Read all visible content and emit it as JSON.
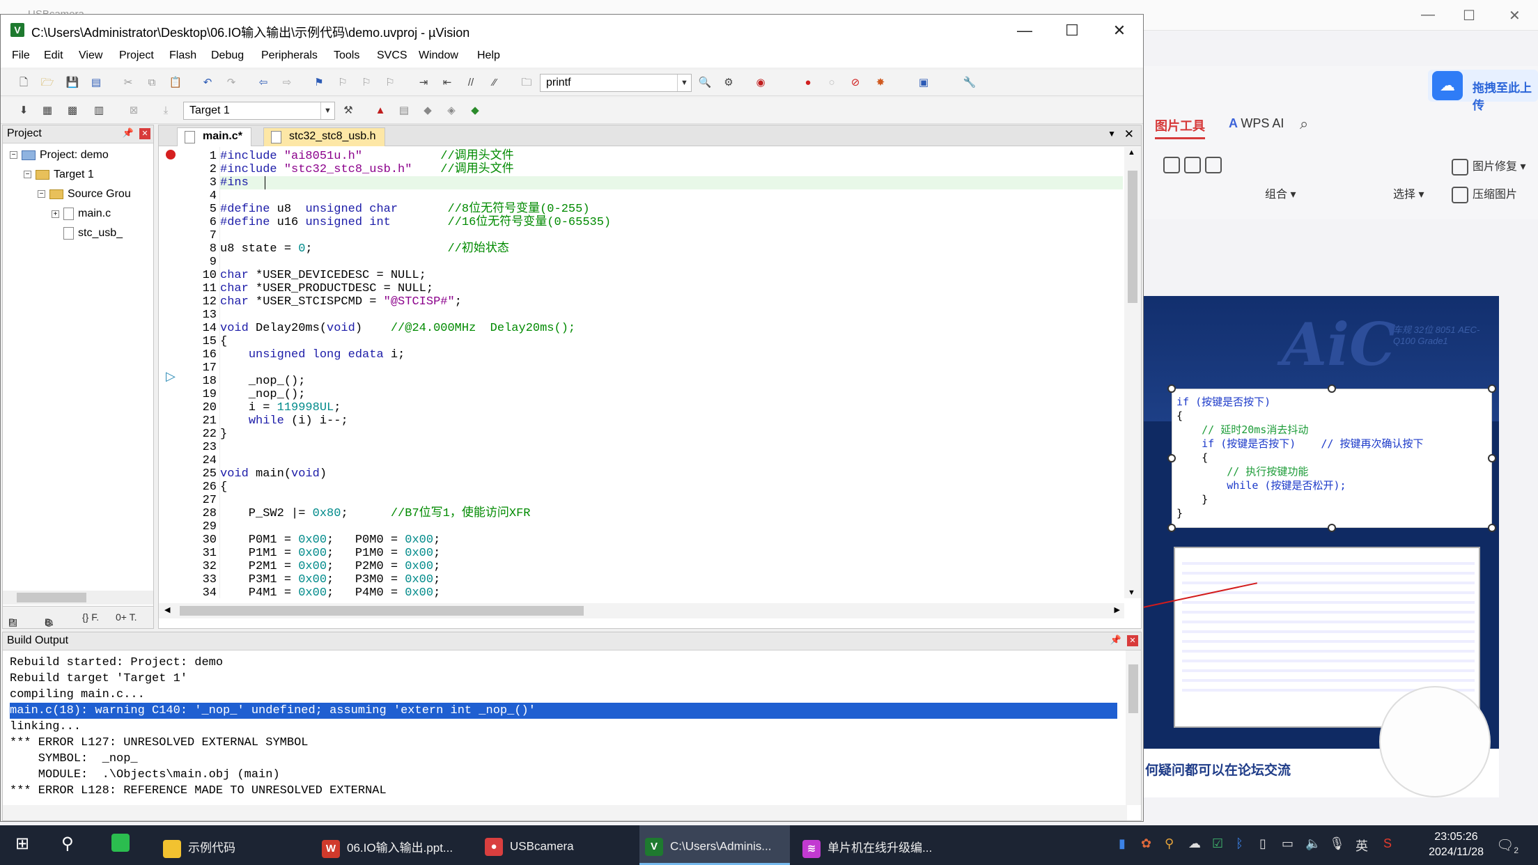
{
  "background_app": {
    "title": "USBcamera",
    "upload_button": "拖拽至此上传",
    "tabs": [
      "图片工具",
      "WPS AI"
    ],
    "tools": [
      "组合",
      "选择",
      "图片修复",
      "压缩图片"
    ],
    "slide": {
      "logo": "AiC",
      "subtitle": "车规 32位 8051  AEC-Q100 Grade1",
      "code_lines": [
        "if (按键是否按下)",
        "{",
        "    // 延时20ms消去抖动",
        "    if (按键是否按下)    // 按键再次确认按下",
        "    {",
        "        // 执行按键功能",
        "        while (按键是否松开);",
        "    }",
        "}"
      ],
      "caption": "何疑问都可以在论坛交流"
    }
  },
  "window": {
    "title": "C:\\Users\\Administrator\\Desktop\\06.IO输入输出\\示例代码\\demo.uvproj - µVision",
    "controls": {
      "minimize": "—",
      "maximize": "☐",
      "close": "✕"
    }
  },
  "menu": [
    "File",
    "Edit",
    "View",
    "Project",
    "Flash",
    "Debug",
    "Peripherals",
    "Tools",
    "SVCS",
    "Window",
    "Help"
  ],
  "toolbar": {
    "find_combo": "printf",
    "target_combo": "Target 1"
  },
  "project_panel": {
    "title": "Project",
    "tree": [
      {
        "label": "Project: demo",
        "level": 0
      },
      {
        "label": "Target 1",
        "level": 1
      },
      {
        "label": "Source Grou",
        "level": 2
      },
      {
        "label": "main.c",
        "level": 3
      },
      {
        "label": "stc_usb_",
        "level": 3
      }
    ],
    "bottom_tabs": [
      "P.",
      "B.",
      "{} F.",
      "0+ T."
    ]
  },
  "editor": {
    "tabs": [
      {
        "label": "main.c*",
        "active": true
      },
      {
        "label": "stc32_stc8_usb.h",
        "active": false
      }
    ],
    "breakpoint_line": 1,
    "cursor_line": 18,
    "lines": [
      "#include \"ai8051u.h\"           //调用头文件",
      "#include \"stc32_stc8_usb.h\"    //调用头文件",
      "#ins",
      "",
      "#define u8  unsigned char       //8位无符号变量(0-255)",
      "#define u16 unsigned int        //16位无符号变量(0-65535)",
      "",
      "u8 state = 0;                   //初始状态",
      "",
      "char *USER_DEVICEDESC = NULL;",
      "char *USER_PRODUCTDESC = NULL;",
      "char *USER_STCISPCMD = \"@STCISP#\";",
      "",
      "void Delay20ms(void)    //@24.000MHz  Delay20ms();",
      "{",
      "    unsigned long edata i;",
      "",
      "    _nop_();",
      "    _nop_();",
      "    i = 119998UL;",
      "    while (i) i--;",
      "}",
      "",
      "",
      "void main(void)",
      "{",
      "",
      "    P_SW2 |= 0x80;      //B7位写1，使能访问XFR",
      "",
      "    P0M1 = 0x00;   P0M0 = 0x00;",
      "    P1M1 = 0x00;   P1M0 = 0x00;",
      "    P2M1 = 0x00;   P2M0 = 0x00;",
      "    P3M1 = 0x00;   P3M0 = 0x00;",
      "    P4M1 = 0x00;   P4M0 = 0x00;"
    ]
  },
  "build_output": {
    "title": "Build Output",
    "selected_index": 3,
    "lines": [
      "Rebuild started: Project: demo",
      "Rebuild target 'Target 1'",
      "compiling main.c...",
      "main.c(18): warning C140: '_nop_' undefined; assuming 'extern int _nop_()'",
      "linking...",
      "*** ERROR L127: UNRESOLVED EXTERNAL SYMBOL",
      "    SYMBOL:  _nop_",
      "    MODULE:  .\\Objects\\main.obj (main)",
      "*** ERROR L128: REFERENCE MADE TO UNRESOLVED EXTERNAL",
      "    SYMBOL:  _nop_"
    ]
  },
  "taskbar": {
    "items": [
      {
        "label": "示例代码",
        "icon_color": "#f2c230"
      },
      {
        "label": "06.IO输入输出.ppt...",
        "icon_color": "#d03a2c"
      },
      {
        "label": "USBcamera",
        "icon_color": "#d93f3f"
      },
      {
        "label": "C:\\Users\\Adminis...",
        "icon_color": "#1e7a2f",
        "active": true
      },
      {
        "label": "单片机在线升级编...",
        "icon_color": "#c23ad1"
      }
    ],
    "ime": "英",
    "time": "23:05:26",
    "date": "2024/11/28",
    "notifications": "2"
  }
}
